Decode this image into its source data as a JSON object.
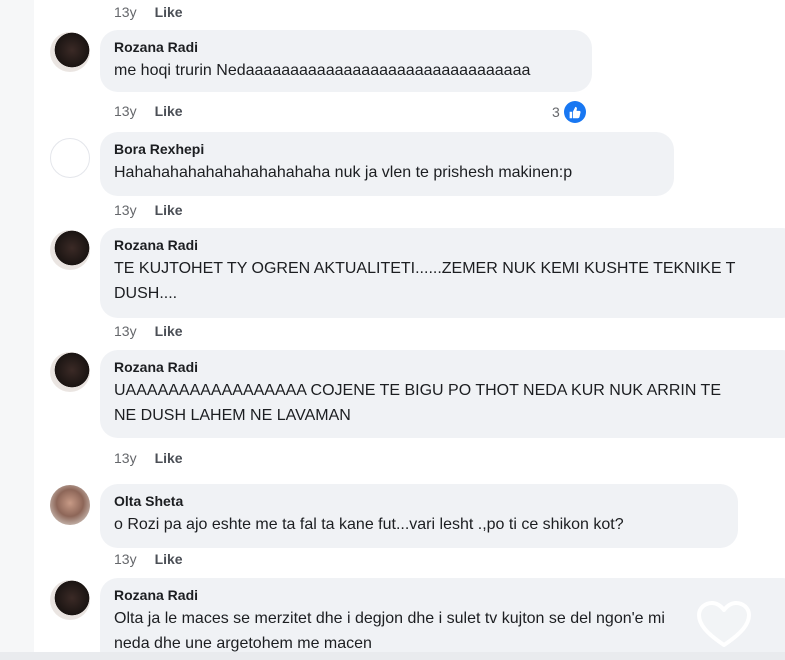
{
  "comments": [
    {
      "author": "Rozana Radi",
      "lines": [
        "me hoqi trurin Nedaaaaaaaaaaaaaaaaaaaaaaaaaaaaaaaa"
      ],
      "time": "13y",
      "like": "Like",
      "reactions": "3"
    },
    {
      "author": "Bora Rexhepi",
      "lines": [
        "Hahahahahahahahahahahaha nuk ja vlen te prishesh makinen:p"
      ],
      "time": "13y",
      "like": "Like"
    },
    {
      "author": "Rozana Radi",
      "lines": [
        "TE KUJTOHET TY OGREN AKTUALITETI......ZEMER NUK KEMI KUSHTE TEKNIKE T",
        "DUSH...."
      ],
      "time": "13y",
      "like": "Like"
    },
    {
      "author": "Rozana Radi",
      "lines": [
        "UAAAAAAAAAAAAAAAAA COJENE TE BIGU PO THOT NEDA KUR NUK ARRIN TE",
        "NE DUSH LAHEM NE LAVAMAN"
      ],
      "time": "13y",
      "like": "Like"
    },
    {
      "author": "Olta Sheta",
      "lines": [
        "o Rozi pa ajo eshte me ta fal ta kane fut...vari lesht .,po ti ce shikon kot?"
      ],
      "time": "13y",
      "like": "Like"
    },
    {
      "author": "Rozana Radi",
      "lines": [
        "Olta ja le maces se merzitet dhe i degjon dhe i sulet tv kujton se del ngon'e mi",
        "neda dhe une argetohem me macen"
      ]
    }
  ],
  "top_meta": {
    "time": "13y",
    "like": "Like"
  },
  "icons": {
    "like_badge": "thumbs-up-icon",
    "overlay": "heart-outline-icon"
  },
  "colors": {
    "bubble": "#f0f2f5",
    "like_blue": "#1877f2",
    "meta_gray": "#65676b"
  }
}
